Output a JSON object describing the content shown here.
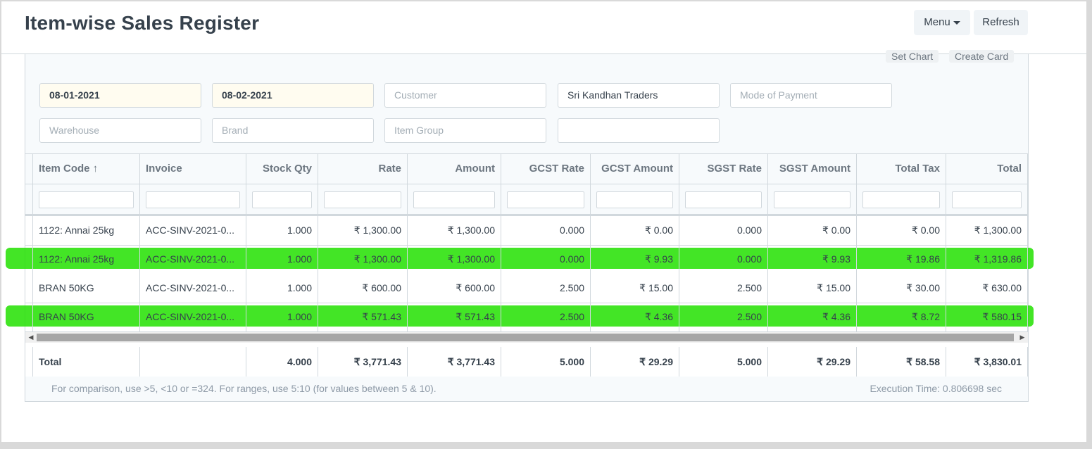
{
  "header": {
    "title": "Item-wise Sales Register",
    "menu_label": "Menu",
    "refresh_label": "Refresh"
  },
  "chart_buttons": {
    "set_chart": "Set Chart",
    "create_card": "Create Card"
  },
  "filters": {
    "from_date": "08-01-2021",
    "to_date": "08-02-2021",
    "customer_placeholder": "Customer",
    "customer_group_value": "Sri Kandhan Traders",
    "mode_of_payment_placeholder": "Mode of Payment",
    "warehouse_placeholder": "Warehouse",
    "brand_placeholder": "Brand",
    "item_group_placeholder": "Item Group"
  },
  "table": {
    "columns": [
      "Item Code ↑",
      "Invoice",
      "Stock Qty",
      "Rate",
      "Amount",
      "GCST Rate",
      "GCST Amount",
      "SGST Rate",
      "SGST Amount",
      "Total Tax",
      "Total"
    ],
    "rows": [
      [
        "1122: Annai 25kg",
        "ACC-SINV-2021-0...",
        "1.000",
        "₹ 1,300.00",
        "₹ 1,300.00",
        "0.000",
        "₹ 0.00",
        "0.000",
        "₹ 0.00",
        "₹ 0.00",
        "₹ 1,300.00"
      ],
      [
        "1122: Annai 25kg",
        "ACC-SINV-2021-0...",
        "1.000",
        "₹ 1,300.00",
        "₹ 1,300.00",
        "0.000",
        "₹ 9.93",
        "0.000",
        "₹ 9.93",
        "₹ 19.86",
        "₹ 1,319.86"
      ],
      [
        "BRAN 50KG",
        "ACC-SINV-2021-0...",
        "1.000",
        "₹ 600.00",
        "₹ 600.00",
        "2.500",
        "₹ 15.00",
        "2.500",
        "₹ 15.00",
        "₹ 30.00",
        "₹ 630.00"
      ],
      [
        "BRAN 50KG",
        "ACC-SINV-2021-0...",
        "1.000",
        "₹ 571.43",
        "₹ 571.43",
        "2.500",
        "₹ 4.36",
        "2.500",
        "₹ 4.36",
        "₹ 8.72",
        "₹ 580.15"
      ]
    ],
    "totals": [
      "Total",
      "",
      "4.000",
      "₹ 3,771.43",
      "₹ 3,771.43",
      "5.000",
      "₹ 29.29",
      "5.000",
      "₹ 29.29",
      "₹ 58.58",
      "₹ 3,830.01"
    ]
  },
  "footer": {
    "help_text": "For comparison, use >5, <10 or =324. For ranges, use 5:10 (for values between 5 & 10).",
    "execution_time": "Execution Time: 0.806698 sec"
  },
  "colors": {
    "highlight": "#22e000",
    "text": "#36414c",
    "muted": "#8d99a6"
  }
}
